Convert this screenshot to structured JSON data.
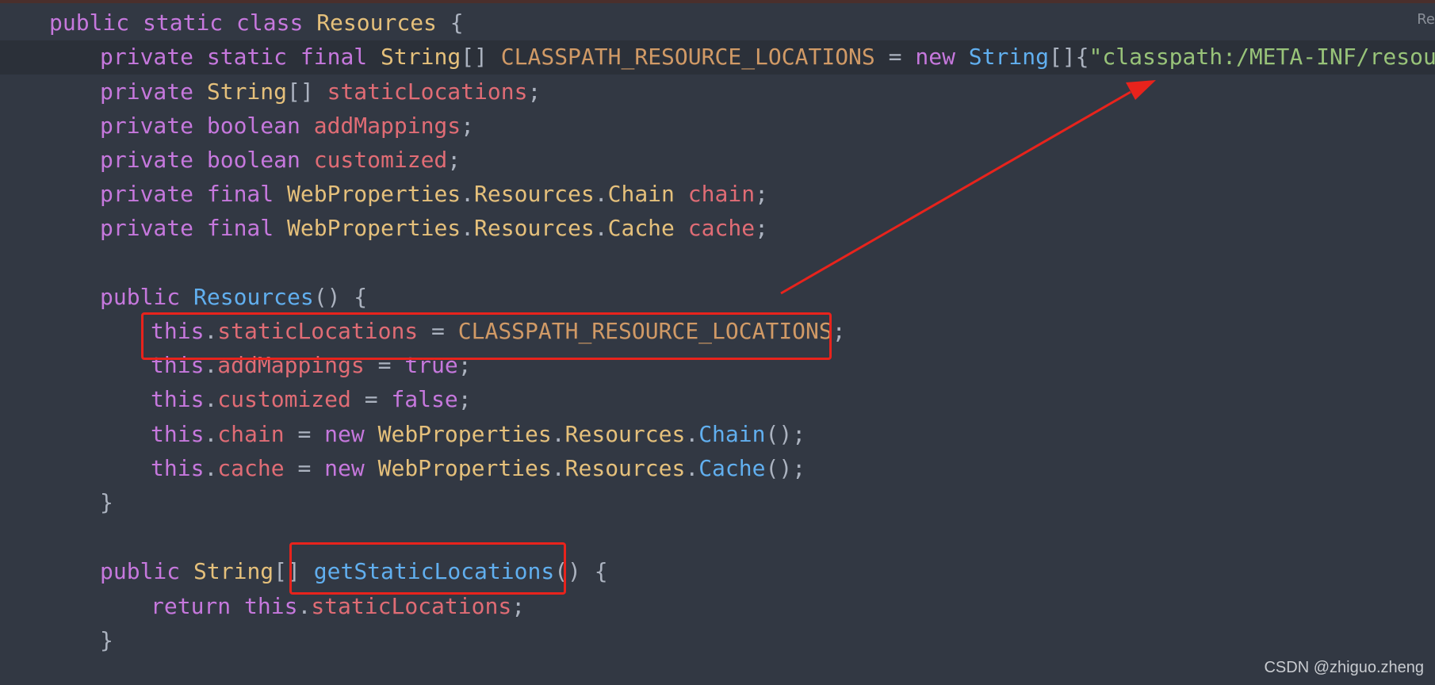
{
  "corner_label": "Re",
  "watermark": "CSDN @zhiguo.zheng",
  "colors": {
    "background": "#323843",
    "keyword": "#c678dd",
    "type": "#e5c07b",
    "field": "#e06c75",
    "constant": "#d19a66",
    "method": "#61afef",
    "string": "#98c379",
    "annotation_red": "#e8231c"
  },
  "code": {
    "lines": [
      {
        "tokens": [
          {
            "t": "public ",
            "c": "kw"
          },
          {
            "t": "static ",
            "c": "kw"
          },
          {
            "t": "class ",
            "c": "kw"
          },
          {
            "t": "Resources",
            "c": "type"
          },
          {
            "t": " {",
            "c": "punct"
          }
        ]
      },
      {
        "tokens": [
          {
            "t": "private ",
            "c": "kw"
          },
          {
            "t": "static ",
            "c": "kw"
          },
          {
            "t": "final ",
            "c": "kw"
          },
          {
            "t": "String",
            "c": "type"
          },
          {
            "t": "[] ",
            "c": "punct"
          },
          {
            "t": "CLASSPATH_RESOURCE_LOCATIONS",
            "c": "const"
          },
          {
            "t": " = ",
            "c": "punct"
          },
          {
            "t": "new ",
            "c": "kw"
          },
          {
            "t": "String",
            "c": "call"
          },
          {
            "t": "[]{",
            "c": "punct"
          },
          {
            "t": "\"classpath:/META-INF/resources/",
            "c": "str"
          }
        ]
      },
      {
        "tokens": [
          {
            "t": "private ",
            "c": "kw"
          },
          {
            "t": "String",
            "c": "type"
          },
          {
            "t": "[] ",
            "c": "punct"
          },
          {
            "t": "staticLocations",
            "c": "field"
          },
          {
            "t": ";",
            "c": "punct"
          }
        ]
      },
      {
        "tokens": [
          {
            "t": "private ",
            "c": "kw"
          },
          {
            "t": "boolean ",
            "c": "kw"
          },
          {
            "t": "addMappings",
            "c": "field"
          },
          {
            "t": ";",
            "c": "punct"
          }
        ]
      },
      {
        "tokens": [
          {
            "t": "private ",
            "c": "kw"
          },
          {
            "t": "boolean ",
            "c": "kw"
          },
          {
            "t": "customized",
            "c": "field"
          },
          {
            "t": ";",
            "c": "punct"
          }
        ]
      },
      {
        "tokens": [
          {
            "t": "private ",
            "c": "kw"
          },
          {
            "t": "final ",
            "c": "kw"
          },
          {
            "t": "WebProperties",
            "c": "type"
          },
          {
            "t": ".",
            "c": "punct"
          },
          {
            "t": "Resources",
            "c": "type"
          },
          {
            "t": ".",
            "c": "punct"
          },
          {
            "t": "Chain",
            "c": "type"
          },
          {
            "t": " ",
            "c": "punct"
          },
          {
            "t": "chain",
            "c": "field"
          },
          {
            "t": ";",
            "c": "punct"
          }
        ]
      },
      {
        "tokens": [
          {
            "t": "private ",
            "c": "kw"
          },
          {
            "t": "final ",
            "c": "kw"
          },
          {
            "t": "WebProperties",
            "c": "type"
          },
          {
            "t": ".",
            "c": "punct"
          },
          {
            "t": "Resources",
            "c": "type"
          },
          {
            "t": ".",
            "c": "punct"
          },
          {
            "t": "Cache",
            "c": "type"
          },
          {
            "t": " ",
            "c": "punct"
          },
          {
            "t": "cache",
            "c": "field"
          },
          {
            "t": ";",
            "c": "punct"
          }
        ]
      },
      {
        "tokens": []
      },
      {
        "tokens": [
          {
            "t": "public ",
            "c": "kw"
          },
          {
            "t": "Resources",
            "c": "call"
          },
          {
            "t": "() {",
            "c": "punct"
          }
        ]
      },
      {
        "tokens": [
          {
            "t": "this",
            "c": "kw"
          },
          {
            "t": ".",
            "c": "punct"
          },
          {
            "t": "staticLocations",
            "c": "field"
          },
          {
            "t": " = ",
            "c": "punct"
          },
          {
            "t": "CLASSPATH_RESOURCE_LOCATIONS",
            "c": "const"
          },
          {
            "t": ";",
            "c": "punct"
          }
        ]
      },
      {
        "tokens": [
          {
            "t": "this",
            "c": "kw"
          },
          {
            "t": ".",
            "c": "punct"
          },
          {
            "t": "addMappings",
            "c": "field"
          },
          {
            "t": " = ",
            "c": "punct"
          },
          {
            "t": "true",
            "c": "kw"
          },
          {
            "t": ";",
            "c": "punct"
          }
        ]
      },
      {
        "tokens": [
          {
            "t": "this",
            "c": "kw"
          },
          {
            "t": ".",
            "c": "punct"
          },
          {
            "t": "customized",
            "c": "field"
          },
          {
            "t": " = ",
            "c": "punct"
          },
          {
            "t": "false",
            "c": "kw"
          },
          {
            "t": ";",
            "c": "punct"
          }
        ]
      },
      {
        "tokens": [
          {
            "t": "this",
            "c": "kw"
          },
          {
            "t": ".",
            "c": "punct"
          },
          {
            "t": "chain",
            "c": "field"
          },
          {
            "t": " = ",
            "c": "punct"
          },
          {
            "t": "new ",
            "c": "kw"
          },
          {
            "t": "WebProperties",
            "c": "type"
          },
          {
            "t": ".",
            "c": "punct"
          },
          {
            "t": "Resources",
            "c": "type"
          },
          {
            "t": ".",
            "c": "punct"
          },
          {
            "t": "Chain",
            "c": "call"
          },
          {
            "t": "();",
            "c": "punct"
          }
        ]
      },
      {
        "tokens": [
          {
            "t": "this",
            "c": "kw"
          },
          {
            "t": ".",
            "c": "punct"
          },
          {
            "t": "cache",
            "c": "field"
          },
          {
            "t": " = ",
            "c": "punct"
          },
          {
            "t": "new ",
            "c": "kw"
          },
          {
            "t": "WebProperties",
            "c": "type"
          },
          {
            "t": ".",
            "c": "punct"
          },
          {
            "t": "Resources",
            "c": "type"
          },
          {
            "t": ".",
            "c": "punct"
          },
          {
            "t": "Cache",
            "c": "call"
          },
          {
            "t": "();",
            "c": "punct"
          }
        ]
      },
      {
        "tokens": [
          {
            "t": "}",
            "c": "punct"
          }
        ]
      },
      {
        "tokens": []
      },
      {
        "tokens": [
          {
            "t": "public ",
            "c": "kw"
          },
          {
            "t": "String",
            "c": "type"
          },
          {
            "t": "[] ",
            "c": "punct"
          },
          {
            "t": "getStaticLocations",
            "c": "call"
          },
          {
            "t": "() {",
            "c": "punct"
          }
        ]
      },
      {
        "tokens": [
          {
            "t": "return ",
            "c": "kw"
          },
          {
            "t": "this",
            "c": "kw"
          },
          {
            "t": ".",
            "c": "punct"
          },
          {
            "t": "staticLocations",
            "c": "field"
          },
          {
            "t": ";",
            "c": "punct"
          }
        ]
      },
      {
        "tokens": [
          {
            "t": "}",
            "c": "punct"
          }
        ]
      }
    ]
  }
}
